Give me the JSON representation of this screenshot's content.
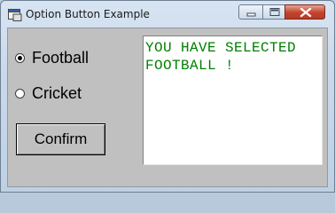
{
  "window": {
    "title": "Option Button Example"
  },
  "options": [
    {
      "label": "Football",
      "selected": true
    },
    {
      "label": "Cricket",
      "selected": false
    }
  ],
  "confirm_label": "Confirm",
  "output_text": "YOU HAVE SELECTED FOOTBALL !",
  "colors": {
    "output_text": "#008000",
    "client_bg": "#c0c0c0"
  },
  "icons": {
    "app": "app-form-icon",
    "minimize": "minimize-icon",
    "maximize": "maximize-icon",
    "close": "close-icon"
  }
}
